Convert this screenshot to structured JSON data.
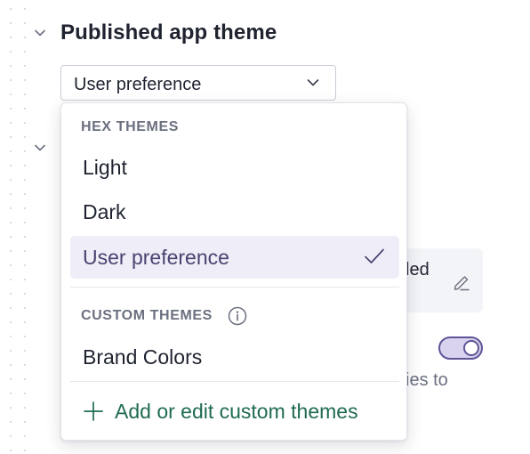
{
  "section": {
    "title": "Published app theme"
  },
  "select": {
    "value": "User preference"
  },
  "menu": {
    "hex_group_label": "HEX THEMES",
    "hex_items": [
      {
        "label": "Light"
      },
      {
        "label": "Dark"
      },
      {
        "label": "User preference",
        "selected": true
      }
    ],
    "custom_group_label": "CUSTOM THEMES",
    "custom_items": [
      {
        "label": "Brand Colors"
      }
    ],
    "add_label": "Add or edit custom themes"
  },
  "background": {
    "card_text_fragment": "led",
    "helper_text_fragment": "ies to",
    "toggle_on": true
  },
  "colors": {
    "accent_purple": "#5f5496",
    "selected_bg": "#efedf7",
    "link_green": "#1f6b52",
    "muted_text": "#6b7080"
  },
  "icons": [
    "chevron-down-icon",
    "caret-down-icon",
    "check-icon",
    "info-icon",
    "plus-icon",
    "edit-icon"
  ]
}
